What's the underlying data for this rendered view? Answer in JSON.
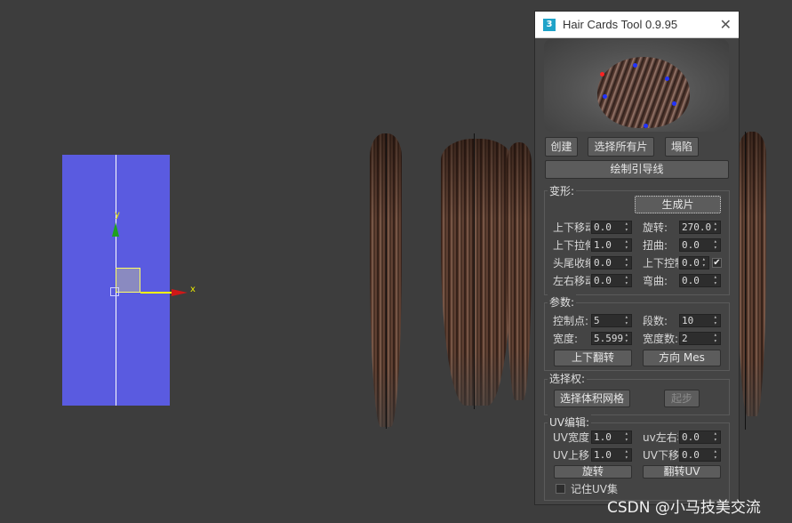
{
  "viewport": {
    "axis_y_label": "y",
    "axis_x_label": "x"
  },
  "panel": {
    "title": "Hair Cards Tool 0.9.95",
    "buttons": {
      "create": "创建",
      "select_all": "选择所有片",
      "collapse": "塌陷",
      "draw_guides": "绘制引导线"
    },
    "deform": {
      "label": "变形:",
      "generate": "生成片",
      "fields": [
        {
          "label": "上下移动",
          "value": "0.0"
        },
        {
          "label": "旋转:",
          "value": "270.0"
        },
        {
          "label": "上下拉伸",
          "value": "1.0"
        },
        {
          "label": "扭曲:",
          "value": "0.0"
        },
        {
          "label": "头尾收缩",
          "value": "0.0"
        },
        {
          "label": "上下控制",
          "value": "0.0"
        },
        {
          "label": "左右移动",
          "value": "0.0"
        },
        {
          "label": "弯曲:",
          "value": "0.0"
        }
      ],
      "check_mark": "✔"
    },
    "params": {
      "label": "参数:",
      "fields": [
        {
          "label": "控制点:",
          "value": "5"
        },
        {
          "label": "段数:",
          "value": "10"
        },
        {
          "label": "宽度:",
          "value": "5.599"
        },
        {
          "label": "宽度数:",
          "value": "2"
        }
      ],
      "flip": "上下翻转",
      "direction": "方向 Mes"
    },
    "select": {
      "label": "选择权:",
      "volume": "选择体积网格",
      "step": "起步"
    },
    "uv": {
      "label": "UV编辑:",
      "fields": [
        {
          "label": "UV宽度:",
          "value": "1.0"
        },
        {
          "label": "uv左右移",
          "value": "0.0"
        },
        {
          "label": "UV上移:",
          "value": "1.0"
        },
        {
          "label": "UV下移:",
          "value": "0.0"
        }
      ],
      "rotate": "旋转",
      "flip_uv": "翻转UV",
      "remember": "记住UV集"
    }
  },
  "watermark": "CSDN @小马技美交流",
  "colors": {
    "uv_plane": "#5a5be0",
    "panel_bg": "#444444",
    "button_bg": "#5c5c5c"
  }
}
